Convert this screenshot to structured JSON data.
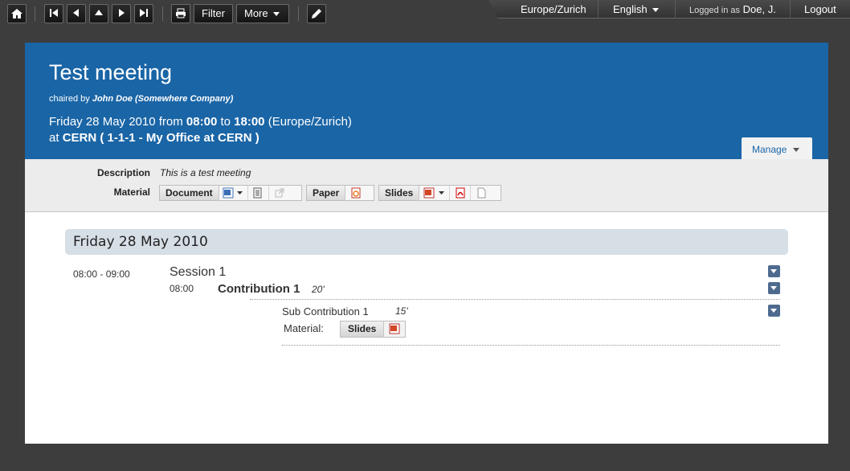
{
  "toolbar": {
    "filter_label": "Filter",
    "more_label": "More"
  },
  "userbar": {
    "timezone": "Europe/Zurich",
    "language": "English",
    "logged_in_prefix": "Logged in as",
    "user": "Doe, J.",
    "logout": "Logout"
  },
  "event": {
    "title": "Test meeting",
    "chaired_prefix": "chaired by",
    "chair": "John Doe (Somewhere Company)",
    "date_text": "Friday 28 May 2010 from",
    "start": "08:00",
    "to_word": "to",
    "end": "18:00",
    "tz_text": "(Europe/Zurich)",
    "at_word": "at",
    "location": "CERN ( 1-1-1 - My Office at CERN )",
    "manage_label": "Manage"
  },
  "info": {
    "description_label": "Description",
    "description": "This is a test meeting",
    "material_label": "Material",
    "materials": [
      "Document",
      "Paper",
      "Slides"
    ]
  },
  "timetable": {
    "day": "Friday 28 May 2010",
    "session_time": "08:00 - 09:00",
    "session_title": "Session 1",
    "contrib_time": "08:00",
    "contrib_title": "Contribution 1",
    "contrib_duration": "20'",
    "sub_title": "Sub Contribution 1",
    "sub_duration": "15'",
    "sub_material_label": "Material:",
    "sub_material": "Slides"
  },
  "colors": {
    "header_blue": "#1a65a6",
    "day_bar": "#d6dee6",
    "arrow_button": "#4e6b8f"
  }
}
